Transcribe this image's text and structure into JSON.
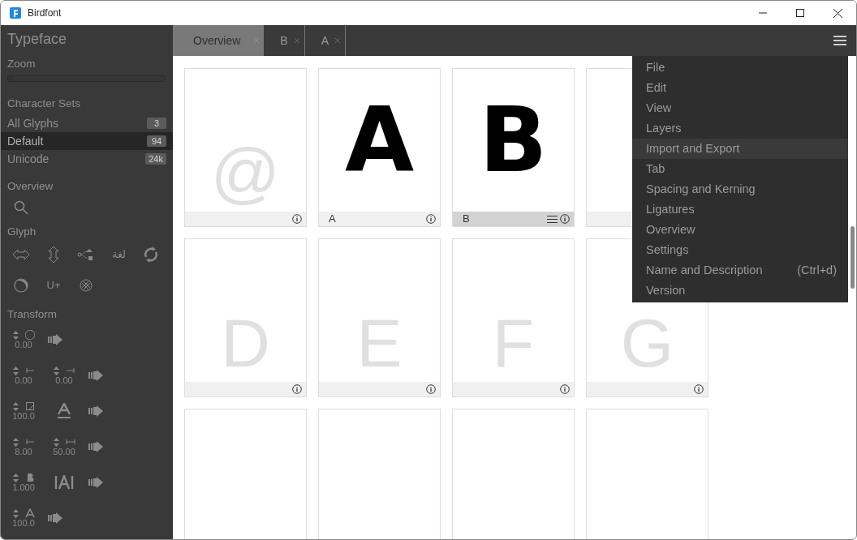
{
  "window": {
    "title": "Birdfont"
  },
  "sidebar": {
    "title": "Typeface",
    "zoom": {
      "label": "Zoom",
      "level": 0
    },
    "character_sets_label": "Character Sets",
    "character_sets": [
      {
        "name": "All Glyphs",
        "count": "3",
        "selected": false
      },
      {
        "name": "Default",
        "count": "94",
        "selected": true
      },
      {
        "name": "Unicode",
        "count": "24k",
        "selected": false
      }
    ],
    "overview_label": "Overview",
    "glyph_label": "Glyph",
    "glyph_tools": [
      {
        "kind": "flip-horizontal"
      },
      {
        "kind": "flip-vertical"
      },
      {
        "kind": "share"
      },
      {
        "kind": "text",
        "text": "لغة"
      },
      {
        "kind": "refresh"
      },
      {
        "kind": "moon"
      },
      {
        "kind": "text",
        "text": "U+"
      },
      {
        "kind": "crosshatch"
      }
    ],
    "transform_label": "Transform",
    "transform_rows": [
      {
        "fields": [
          {
            "kind": "rotate",
            "value": "0.00"
          }
        ]
      },
      {
        "fields": [
          {
            "kind": "left",
            "value": "0.00"
          },
          {
            "kind": "right",
            "value": "0.00"
          }
        ]
      },
      {
        "fields": [
          {
            "kind": "resize",
            "value": "100.0"
          },
          {
            "kind": "underline-a"
          }
        ]
      },
      {
        "fields": [
          {
            "kind": "left",
            "value": "8.00"
          },
          {
            "kind": "width",
            "value": "50.00"
          }
        ]
      },
      {
        "fields": [
          {
            "kind": "bold",
            "value": "1.000"
          },
          {
            "kind": "spacing-a"
          }
        ]
      },
      {
        "fields": [
          {
            "kind": "slant-a",
            "value": "100.0"
          }
        ]
      }
    ]
  },
  "tabs": [
    {
      "label": "Overview",
      "selected": true
    },
    {
      "label": "B",
      "selected": false
    },
    {
      "label": "A",
      "selected": false
    }
  ],
  "glyphs": [
    {
      "kind": "placeholder",
      "char": "@",
      "selected": false
    },
    {
      "kind": "drawn",
      "char": "A",
      "label": "A",
      "selected": false
    },
    {
      "kind": "drawn",
      "char": "B",
      "label": "B",
      "selected": true
    },
    {
      "kind": "blank",
      "selected": false
    },
    {
      "kind": "placeholder",
      "char": "D",
      "selected": false
    },
    {
      "kind": "placeholder",
      "char": "E",
      "selected": false
    },
    {
      "kind": "placeholder",
      "char": "F",
      "selected": false
    },
    {
      "kind": "placeholder",
      "char": "G",
      "selected": false
    },
    {
      "kind": "blank"
    },
    {
      "kind": "blank"
    },
    {
      "kind": "blank"
    },
    {
      "kind": "blank"
    }
  ],
  "menu": [
    {
      "label": "File",
      "selected": false
    },
    {
      "label": "Edit",
      "selected": false
    },
    {
      "label": "View",
      "selected": false
    },
    {
      "label": "Layers",
      "selected": false
    },
    {
      "label": "Import and Export",
      "selected": true
    },
    {
      "label": "Tab",
      "selected": false
    },
    {
      "label": "Spacing and Kerning",
      "selected": false
    },
    {
      "label": "Ligatures",
      "selected": false
    },
    {
      "label": "Overview",
      "selected": false
    },
    {
      "label": "Settings",
      "selected": false
    },
    {
      "label": "Name and Description",
      "shortcut": "(Ctrl+d)",
      "selected": false
    },
    {
      "label": "Version",
      "selected": false
    }
  ]
}
